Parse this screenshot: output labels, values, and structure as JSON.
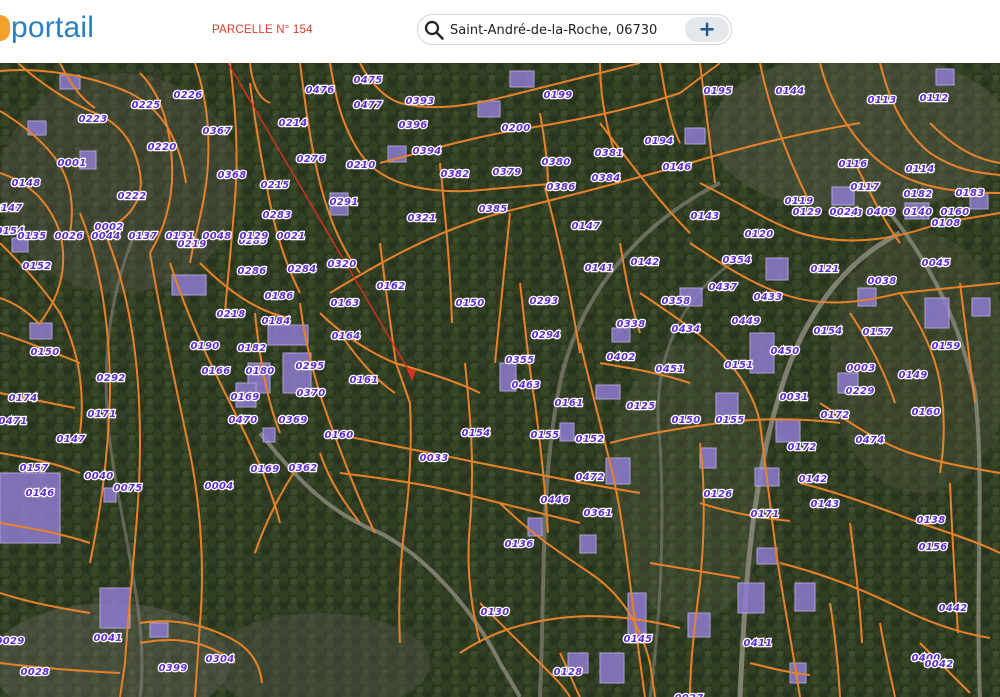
{
  "header": {
    "logo_text": "portail",
    "parcel_callout": "PARCELLE N° 154",
    "search_value": "Saint-André-de-la-Roche, 06730",
    "add_button_label": "+"
  },
  "map": {
    "icons": {
      "search": "search-icon",
      "add": "plus-icon",
      "cursor": "mouse-pointer-icon"
    },
    "colors": {
      "parcel_line": "#e8822a",
      "parcel_label": "#5d2ccf",
      "callout_arrow": "#d9301f",
      "logo_blue": "#2a7fbf",
      "logo_orange": "#f2a12a"
    },
    "parcels": [
      "0475",
      "0476",
      "0477",
      "0393",
      "0223",
      "0225",
      "0226",
      "0214",
      "0367",
      "0396",
      "0200",
      "0199",
      "0195",
      "0144",
      "0113",
      "0112",
      "0220",
      "0001",
      "0276",
      "0210",
      "0394",
      "0382",
      "0379",
      "0380",
      "0381",
      "0194",
      "0146",
      "0116",
      "0114",
      "0148",
      "0222",
      "0215",
      "0368",
      "0291",
      "0386",
      "0384",
      "0117",
      "0182",
      "0183",
      "0147",
      "0002",
      "0283",
      "0219",
      "0321",
      "0385",
      "0147",
      "0143",
      "0119",
      "0118",
      "0108",
      "0154",
      "0285",
      "0120",
      "0152",
      "0286",
      "0284",
      "0320",
      "0162",
      "0141",
      "0142",
      "0354",
      "0121",
      "0045",
      "0186",
      "0163",
      "0150",
      "0293",
      "0358",
      "0437",
      "0433",
      "0038",
      "0218",
      "0184",
      "0164",
      "0338",
      "0434",
      "0449",
      "0154",
      "0157",
      "0190",
      "0182",
      "0294",
      "0402",
      "0450",
      "0159",
      "0150",
      "0166",
      "0295",
      "0355",
      "0451",
      "0151",
      "0003",
      "0292",
      "0180",
      "0161",
      "0463",
      "0149",
      "0229",
      "0174",
      "0169",
      "0370",
      "0161",
      "0150",
      "0155",
      "0172",
      "0171",
      "0470",
      "0369",
      "0125",
      "0031",
      "0160",
      "0147",
      "0160",
      "0155",
      "0152",
      "0474",
      "0471",
      "0169",
      "0033",
      "0154",
      "0142",
      "0157",
      "0146",
      "0362",
      "0172",
      "0040",
      "0004",
      "0472",
      "0126",
      "0143",
      "0446",
      "0361",
      "0171",
      "0138",
      "0156",
      "0442",
      "0029",
      "0041",
      "0145",
      "0411",
      "0400",
      "0028",
      "0399",
      "0128",
      "0027",
      "0410",
      "0042",
      "0304",
      "0075",
      "0136",
      "0130",
      "0129",
      "0024",
      "0409",
      "0140",
      "0160",
      "0135",
      "0026",
      "0044",
      "0137",
      "0131",
      "0048",
      "0129",
      "0021"
    ]
  }
}
